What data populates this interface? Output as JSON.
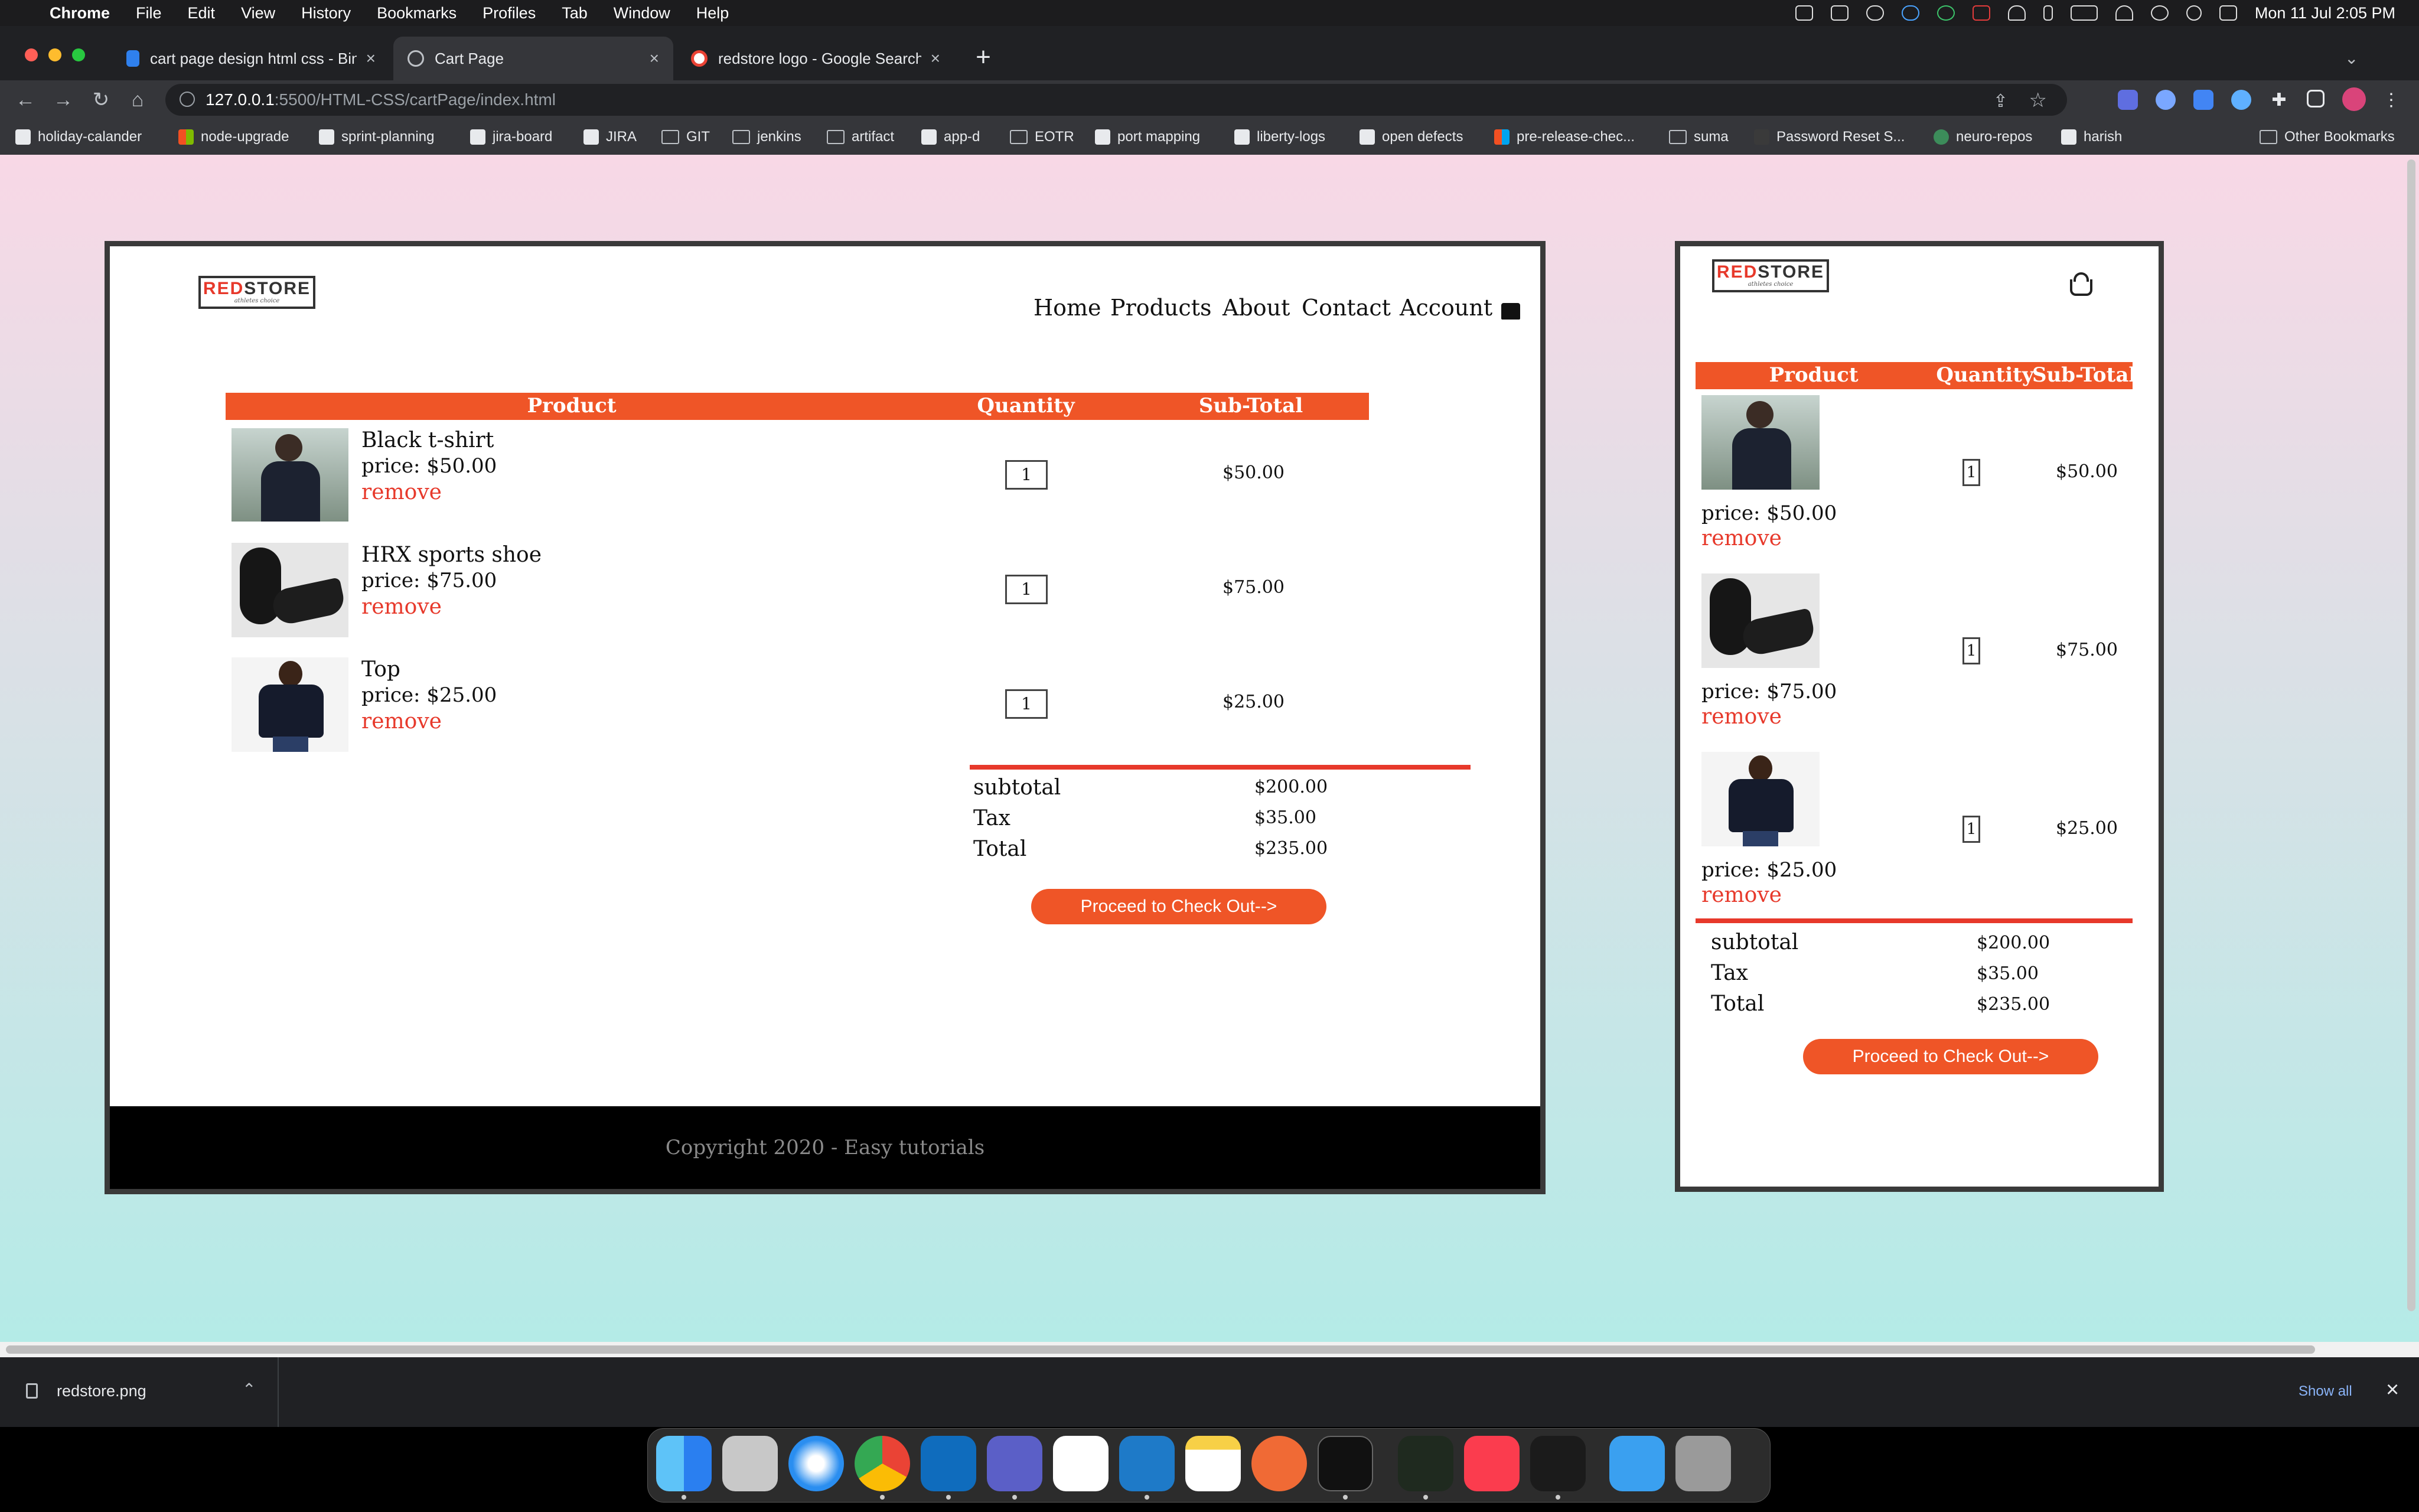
{
  "menubar": {
    "apple": "",
    "items": [
      "Chrome",
      "File",
      "Edit",
      "View",
      "History",
      "Bookmarks",
      "Profiles",
      "Tab",
      "Window",
      "Help"
    ],
    "clock": "Mon 11 Jul  2:05 PM"
  },
  "tabs": [
    {
      "title": "cart page design html css - Bin",
      "close": "×"
    },
    {
      "title": "Cart Page",
      "close": "×"
    },
    {
      "title": "redstore logo - Google Search",
      "close": "×"
    }
  ],
  "new_tab": "+",
  "address": {
    "host": "127.0.0.1",
    "path": ":5500/HTML-CSS/cartPage/index.html"
  },
  "bookmarks": [
    {
      "label": "holiday-calander"
    },
    {
      "label": "node-upgrade"
    },
    {
      "label": "sprint-planning"
    },
    {
      "label": "jira-board"
    },
    {
      "label": "JIRA"
    },
    {
      "label": "GIT"
    },
    {
      "label": "jenkins"
    },
    {
      "label": "artifact"
    },
    {
      "label": "app-d"
    },
    {
      "label": "EOTR"
    },
    {
      "label": "port mapping"
    },
    {
      "label": "liberty-logs"
    },
    {
      "label": "open defects"
    },
    {
      "label": "pre-release-chec..."
    },
    {
      "label": "suma"
    },
    {
      "label": "Password Reset S..."
    },
    {
      "label": "neuro-repos"
    },
    {
      "label": "harish"
    }
  ],
  "other_bookmarks": "Other Bookmarks",
  "page": {
    "logo_red": "RED",
    "logo_rest": "STORE",
    "logo_sub": "athletes choice",
    "nav": [
      "Home",
      "Products",
      "About",
      "Contact",
      "Account"
    ],
    "headers": {
      "product": "Product",
      "quantity": "Quantity",
      "subtotal": "Sub-Total"
    },
    "items": [
      {
        "name": "Black t-shirt",
        "price": "price: $50.00",
        "remove": "remove",
        "qty": "1",
        "subtotal": "$50.00"
      },
      {
        "name": "HRX sports shoe",
        "price": "price: $75.00",
        "remove": "remove",
        "qty": "1",
        "subtotal": "$75.00"
      },
      {
        "name": "Top",
        "price": "price: $25.00",
        "remove": "remove",
        "qty": "1",
        "subtotal": "$25.00"
      }
    ],
    "totals": [
      {
        "label": "subtotal",
        "value": "$200.00"
      },
      {
        "label": "Tax",
        "value": "$35.00"
      },
      {
        "label": "Total",
        "value": "$235.00"
      }
    ],
    "checkout": "Proceed to Check Out-->",
    "footer": "Copyright 2020 - Easy tutorials"
  },
  "downloads": {
    "file": "redstore.png",
    "show_all": "Show all",
    "close": "×"
  },
  "colors": {
    "accent": "#ef5527",
    "remove": "#e7392b"
  }
}
